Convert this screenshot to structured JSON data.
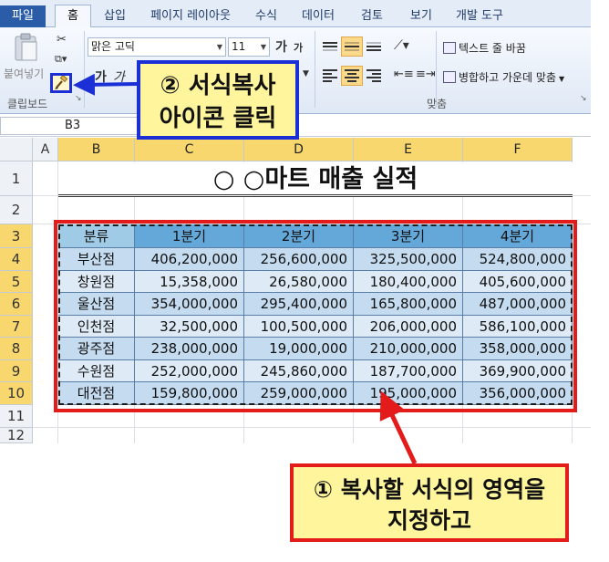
{
  "ribbon": {
    "file_tab": "파일",
    "tabs": [
      "홈",
      "삽입",
      "페이지 레이아웃",
      "수식",
      "데이터",
      "검토",
      "보기",
      "개발 도구"
    ],
    "paste_label": "붙여넣기",
    "clipboard_label": "클립보드",
    "font_name": "맑은 고딕",
    "font_size": "11",
    "grow_glyph": "가",
    "shrink_glyph": "가",
    "bold_glyph": "가",
    "italic_glyph": "가",
    "wrap_text": "텍스트 줄 바꿈",
    "merge_center": "병합하고 가운데 맞춤",
    "alignment_label": "맞춤"
  },
  "formula_bar": {
    "name_box": "B3"
  },
  "sheet": {
    "columns": [
      "A",
      "B",
      "C",
      "D",
      "E",
      "F"
    ],
    "rows": [
      "1",
      "2",
      "3",
      "4",
      "5",
      "6",
      "7",
      "8",
      "9",
      "10",
      "11",
      "12"
    ],
    "title": "○ ○마트 매출 실적",
    "table": {
      "headers": [
        "분류",
        "1분기",
        "2분기",
        "3분기",
        "4분기"
      ],
      "rows": [
        [
          "부산점",
          "406,200,000",
          "256,600,000",
          "325,500,000",
          "524,800,000"
        ],
        [
          "창원점",
          "15,358,000",
          "26,580,000",
          "180,400,000",
          "405,600,000"
        ],
        [
          "울산점",
          "354,000,000",
          "295,400,000",
          "165,800,000",
          "487,000,000"
        ],
        [
          "인천점",
          "32,500,000",
          "100,500,000",
          "206,000,000",
          "586,100,000"
        ],
        [
          "광주점",
          "238,000,000",
          "19,000,000",
          "210,000,000",
          "358,000,000"
        ],
        [
          "수원점",
          "252,000,000",
          "245,860,000",
          "187,700,000",
          "369,900,000"
        ],
        [
          "대전점",
          "159,800,000",
          "259,000,000",
          "195,000,000",
          "356,000,000"
        ]
      ]
    }
  },
  "callouts": {
    "step2_line1": "② 서식복사",
    "step2_line2": "아이콘 클릭",
    "step1_line1": "① 복사할 서식의 영역을",
    "step1_line2": "지정하고"
  },
  "colors": {
    "header_fill": "#63a8d9",
    "band_odd": "#c5dcf0",
    "band_even": "#deebf7",
    "selection": "#f8d86e",
    "callout_fill": "#fff59c",
    "red": "#e41b1b",
    "blue": "#1b2fd6"
  }
}
